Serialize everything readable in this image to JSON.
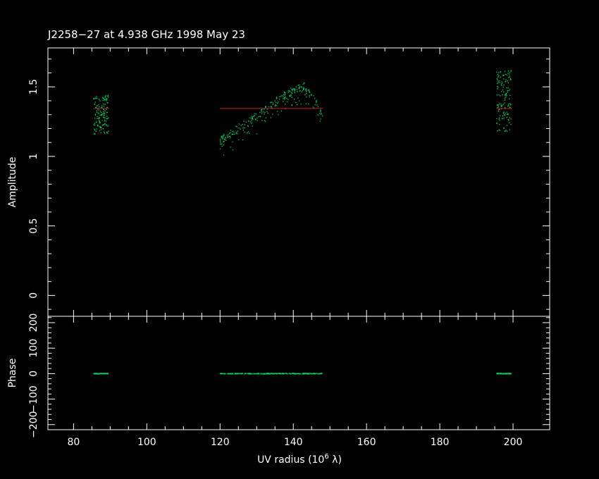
{
  "title": "J2258−27 at 4.938 GHz 1998 May 23",
  "colors": {
    "background": "#000000",
    "axes": "#ffffff",
    "data": "#00dd66",
    "model": "#ff2222"
  },
  "chart_data": {
    "type": "scatter",
    "xlabel": "UV radius",
    "xunit_prefix": "(10",
    "xunit_exp": "6",
    "xunit_suffix": " λ)",
    "xlim": [
      73,
      210
    ],
    "x_ticks": [
      80,
      100,
      120,
      140,
      160,
      180,
      200
    ],
    "panels": [
      {
        "name": "amplitude",
        "ylabel": "Amplitude",
        "ylim": [
          -0.15,
          1.78
        ],
        "y_ticks": [
          "0",
          "0.5",
          "1",
          "1.5"
        ],
        "y_tick_values": [
          0,
          0.5,
          1,
          1.5
        ],
        "model": [
          {
            "x_range": [
              85.5,
              89.5
            ],
            "y": 1.345
          },
          {
            "x_range": [
              120,
              148
            ],
            "y": 1.345
          },
          {
            "x_range": [
              195.5,
              199.5
            ],
            "y": 1.345
          }
        ],
        "clusters": [
          {
            "x_range": [
              85.5,
              89.5
            ],
            "y_range": [
              1.16,
              1.44
            ]
          },
          {
            "x_range": [
              120,
              148
            ],
            "trend": [
              [
                120,
                1.11
              ],
              [
                126,
                1.22
              ],
              [
                132,
                1.33
              ],
              [
                138,
                1.45
              ],
              [
                143,
                1.5
              ],
              [
                146,
                1.4
              ],
              [
                148,
                1.28
              ]
            ]
          },
          {
            "x_range": [
              195.5,
              199.5
            ],
            "y_range": [
              1.18,
              1.62
            ]
          }
        ]
      },
      {
        "name": "phase",
        "ylabel": "Phase",
        "ylim": [
          -220,
          225
        ],
        "y_ticks": [
          "−200",
          "−100",
          "0",
          "100",
          "200"
        ],
        "y_tick_values": [
          -200,
          -100,
          0,
          100,
          200
        ],
        "clusters": [
          {
            "x_range": [
              85.5,
              89.5
            ],
            "y": 0
          },
          {
            "x_range": [
              120,
              148
            ],
            "y": 0
          },
          {
            "x_range": [
              195.5,
              199.5
            ],
            "y": 0
          }
        ]
      }
    ]
  }
}
